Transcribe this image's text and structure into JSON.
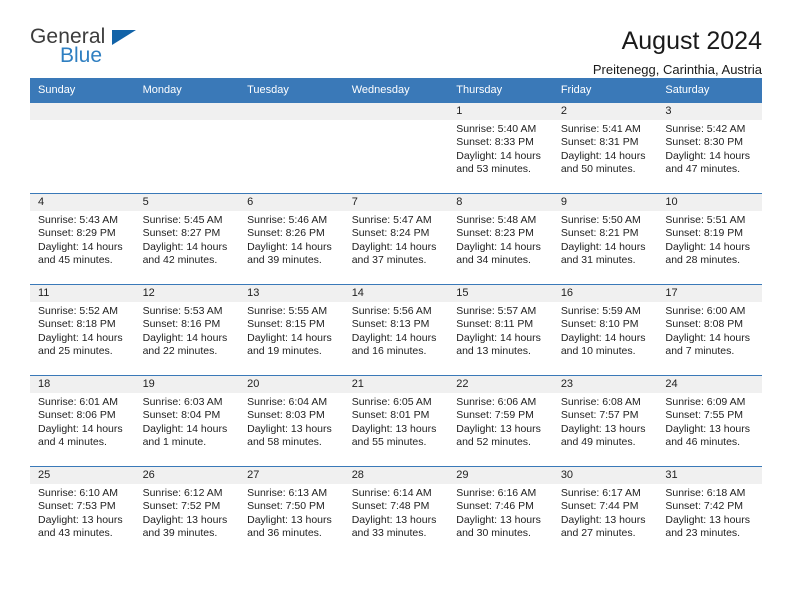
{
  "logo": {
    "word1": "General",
    "word2": "Blue",
    "triangle_color": "#1263a8",
    "blue_color": "#2f7fc1"
  },
  "header": {
    "title": "August 2024",
    "subtitle": "Preitenegg, Carinthia, Austria"
  },
  "theme": {
    "header_blue": "#3a79b8",
    "daynum_band": "#f0f0f0",
    "text": "#222222"
  },
  "calendar": {
    "weekday_headers": [
      "Sunday",
      "Monday",
      "Tuesday",
      "Wednesday",
      "Thursday",
      "Friday",
      "Saturday"
    ],
    "weeks": [
      [
        {
          "day": "",
          "empty": true
        },
        {
          "day": "",
          "empty": true
        },
        {
          "day": "",
          "empty": true
        },
        {
          "day": "",
          "empty": true
        },
        {
          "day": "1",
          "sunrise": "Sunrise: 5:40 AM",
          "sunset": "Sunset: 8:33 PM",
          "daylight": "Daylight: 14 hours and 53 minutes."
        },
        {
          "day": "2",
          "sunrise": "Sunrise: 5:41 AM",
          "sunset": "Sunset: 8:31 PM",
          "daylight": "Daylight: 14 hours and 50 minutes."
        },
        {
          "day": "3",
          "sunrise": "Sunrise: 5:42 AM",
          "sunset": "Sunset: 8:30 PM",
          "daylight": "Daylight: 14 hours and 47 minutes."
        }
      ],
      [
        {
          "day": "4",
          "sunrise": "Sunrise: 5:43 AM",
          "sunset": "Sunset: 8:29 PM",
          "daylight": "Daylight: 14 hours and 45 minutes."
        },
        {
          "day": "5",
          "sunrise": "Sunrise: 5:45 AM",
          "sunset": "Sunset: 8:27 PM",
          "daylight": "Daylight: 14 hours and 42 minutes."
        },
        {
          "day": "6",
          "sunrise": "Sunrise: 5:46 AM",
          "sunset": "Sunset: 8:26 PM",
          "daylight": "Daylight: 14 hours and 39 minutes."
        },
        {
          "day": "7",
          "sunrise": "Sunrise: 5:47 AM",
          "sunset": "Sunset: 8:24 PM",
          "daylight": "Daylight: 14 hours and 37 minutes."
        },
        {
          "day": "8",
          "sunrise": "Sunrise: 5:48 AM",
          "sunset": "Sunset: 8:23 PM",
          "daylight": "Daylight: 14 hours and 34 minutes."
        },
        {
          "day": "9",
          "sunrise": "Sunrise: 5:50 AM",
          "sunset": "Sunset: 8:21 PM",
          "daylight": "Daylight: 14 hours and 31 minutes."
        },
        {
          "day": "10",
          "sunrise": "Sunrise: 5:51 AM",
          "sunset": "Sunset: 8:19 PM",
          "daylight": "Daylight: 14 hours and 28 minutes."
        }
      ],
      [
        {
          "day": "11",
          "sunrise": "Sunrise: 5:52 AM",
          "sunset": "Sunset: 8:18 PM",
          "daylight": "Daylight: 14 hours and 25 minutes."
        },
        {
          "day": "12",
          "sunrise": "Sunrise: 5:53 AM",
          "sunset": "Sunset: 8:16 PM",
          "daylight": "Daylight: 14 hours and 22 minutes."
        },
        {
          "day": "13",
          "sunrise": "Sunrise: 5:55 AM",
          "sunset": "Sunset: 8:15 PM",
          "daylight": "Daylight: 14 hours and 19 minutes."
        },
        {
          "day": "14",
          "sunrise": "Sunrise: 5:56 AM",
          "sunset": "Sunset: 8:13 PM",
          "daylight": "Daylight: 14 hours and 16 minutes."
        },
        {
          "day": "15",
          "sunrise": "Sunrise: 5:57 AM",
          "sunset": "Sunset: 8:11 PM",
          "daylight": "Daylight: 14 hours and 13 minutes."
        },
        {
          "day": "16",
          "sunrise": "Sunrise: 5:59 AM",
          "sunset": "Sunset: 8:10 PM",
          "daylight": "Daylight: 14 hours and 10 minutes."
        },
        {
          "day": "17",
          "sunrise": "Sunrise: 6:00 AM",
          "sunset": "Sunset: 8:08 PM",
          "daylight": "Daylight: 14 hours and 7 minutes."
        }
      ],
      [
        {
          "day": "18",
          "sunrise": "Sunrise: 6:01 AM",
          "sunset": "Sunset: 8:06 PM",
          "daylight": "Daylight: 14 hours and 4 minutes."
        },
        {
          "day": "19",
          "sunrise": "Sunrise: 6:03 AM",
          "sunset": "Sunset: 8:04 PM",
          "daylight": "Daylight: 14 hours and 1 minute."
        },
        {
          "day": "20",
          "sunrise": "Sunrise: 6:04 AM",
          "sunset": "Sunset: 8:03 PM",
          "daylight": "Daylight: 13 hours and 58 minutes."
        },
        {
          "day": "21",
          "sunrise": "Sunrise: 6:05 AM",
          "sunset": "Sunset: 8:01 PM",
          "daylight": "Daylight: 13 hours and 55 minutes."
        },
        {
          "day": "22",
          "sunrise": "Sunrise: 6:06 AM",
          "sunset": "Sunset: 7:59 PM",
          "daylight": "Daylight: 13 hours and 52 minutes."
        },
        {
          "day": "23",
          "sunrise": "Sunrise: 6:08 AM",
          "sunset": "Sunset: 7:57 PM",
          "daylight": "Daylight: 13 hours and 49 minutes."
        },
        {
          "day": "24",
          "sunrise": "Sunrise: 6:09 AM",
          "sunset": "Sunset: 7:55 PM",
          "daylight": "Daylight: 13 hours and 46 minutes."
        }
      ],
      [
        {
          "day": "25",
          "sunrise": "Sunrise: 6:10 AM",
          "sunset": "Sunset: 7:53 PM",
          "daylight": "Daylight: 13 hours and 43 minutes."
        },
        {
          "day": "26",
          "sunrise": "Sunrise: 6:12 AM",
          "sunset": "Sunset: 7:52 PM",
          "daylight": "Daylight: 13 hours and 39 minutes."
        },
        {
          "day": "27",
          "sunrise": "Sunrise: 6:13 AM",
          "sunset": "Sunset: 7:50 PM",
          "daylight": "Daylight: 13 hours and 36 minutes."
        },
        {
          "day": "28",
          "sunrise": "Sunrise: 6:14 AM",
          "sunset": "Sunset: 7:48 PM",
          "daylight": "Daylight: 13 hours and 33 minutes."
        },
        {
          "day": "29",
          "sunrise": "Sunrise: 6:16 AM",
          "sunset": "Sunset: 7:46 PM",
          "daylight": "Daylight: 13 hours and 30 minutes."
        },
        {
          "day": "30",
          "sunrise": "Sunrise: 6:17 AM",
          "sunset": "Sunset: 7:44 PM",
          "daylight": "Daylight: 13 hours and 27 minutes."
        },
        {
          "day": "31",
          "sunrise": "Sunrise: 6:18 AM",
          "sunset": "Sunset: 7:42 PM",
          "daylight": "Daylight: 13 hours and 23 minutes."
        }
      ]
    ]
  }
}
